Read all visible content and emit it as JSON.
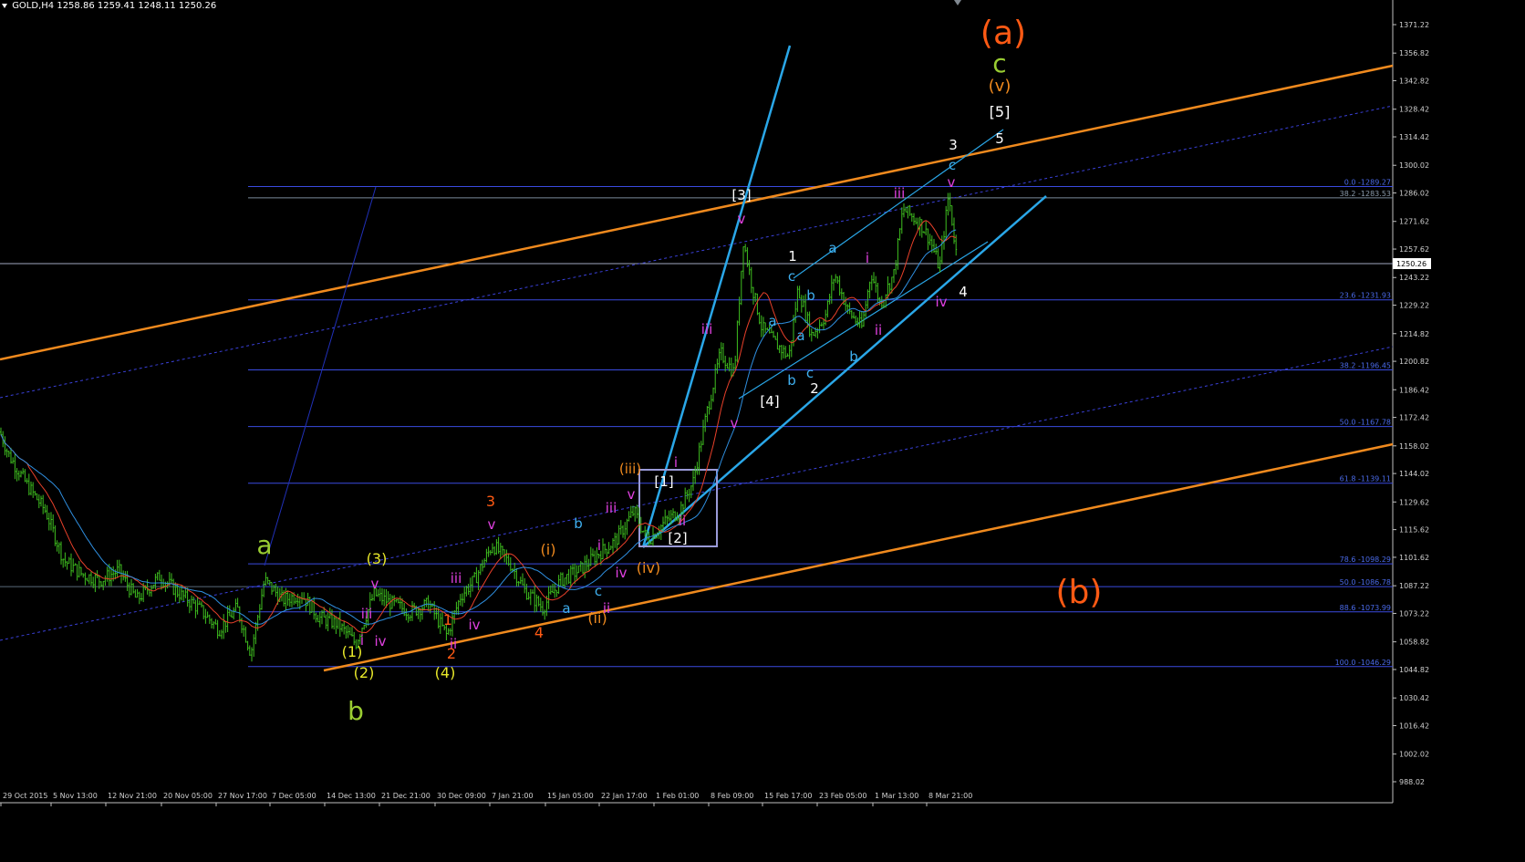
{
  "header": {
    "symbol": "GOLD,H4",
    "ohlc": "1258.86 1259.41 1248.11 1250.26"
  },
  "colors": {
    "background": "#000000",
    "candles": "#3fbf1f",
    "ma_fast": "#e8402a",
    "ma_slow": "#2f8fe0",
    "fib_lines": "#3a4be0",
    "channel_orange": "#f08a1e",
    "channel_dotted": "#3a40d8",
    "trend_cyan": "#2aa7e8",
    "box": "#9a9ad8",
    "axis": "#c0c0c0"
  },
  "chart_data": {
    "type": "candlestick",
    "symbol": "GOLD",
    "timeframe": "H4",
    "last_price": "1250.26",
    "ylim": [
      988.0,
      1381.0
    ],
    "y_ticks": [
      "1371.22",
      "1356.82",
      "1342.82",
      "1328.42",
      "1314.42",
      "1300.02",
      "1286.02",
      "1271.62",
      "1257.62",
      "1243.22",
      "1229.22",
      "1214.82",
      "1200.82",
      "1186.42",
      "1172.42",
      "1158.02",
      "1144.02",
      "1129.62",
      "1115.62",
      "1101.62",
      "1087.22",
      "1073.22",
      "1058.82",
      "1044.82",
      "1030.42",
      "1016.42",
      "1002.02",
      "988.02"
    ],
    "x_ticks": [
      "29 Oct 2015",
      "5 Nov 13:00",
      "12 Nov 21:00",
      "20 Nov 05:00",
      "27 Nov 17:00",
      "7 Dec 05:00",
      "14 Dec 13:00",
      "21 Dec 21:00",
      "30 Dec 09:00",
      "7 Jan 21:00",
      "15 Jan 05:00",
      "22 Jan 17:00",
      "1 Feb 01:00",
      "8 Feb 09:00",
      "15 Feb 17:00",
      "23 Feb 05:00",
      "1 Mar 13:00",
      "8 Mar 21:00"
    ],
    "price_path": [
      [
        0,
        1165
      ],
      [
        10,
        1153
      ],
      [
        30,
        1138
      ],
      [
        50,
        1125
      ],
      [
        70,
        1100
      ],
      [
        90,
        1093
      ],
      [
        110,
        1090
      ],
      [
        130,
        1095
      ],
      [
        150,
        1080
      ],
      [
        175,
        1092
      ],
      [
        200,
        1082
      ],
      [
        220,
        1075
      ],
      [
        240,
        1065
      ],
      [
        260,
        1076
      ],
      [
        275,
        1053
      ],
      [
        290,
        1090
      ],
      [
        310,
        1080
      ],
      [
        330,
        1083
      ],
      [
        350,
        1071
      ],
      [
        370,
        1068
      ],
      [
        390,
        1058
      ],
      [
        410,
        1083
      ],
      [
        430,
        1078
      ],
      [
        450,
        1074
      ],
      [
        470,
        1078
      ],
      [
        490,
        1062
      ],
      [
        505,
        1082
      ],
      [
        520,
        1090
      ],
      [
        540,
        1108
      ],
      [
        560,
        1098
      ],
      [
        575,
        1085
      ],
      [
        595,
        1076
      ],
      [
        615,
        1090
      ],
      [
        635,
        1095
      ],
      [
        655,
        1103
      ],
      [
        675,
        1110
      ],
      [
        695,
        1125
      ],
      [
        710,
        1110
      ],
      [
        730,
        1120
      ],
      [
        745,
        1125
      ],
      [
        760,
        1140
      ],
      [
        775,
        1175
      ],
      [
        790,
        1205
      ],
      [
        805,
        1195
      ],
      [
        815,
        1262
      ],
      [
        825,
        1238
      ],
      [
        835,
        1218
      ],
      [
        850,
        1210
      ],
      [
        865,
        1203
      ],
      [
        875,
        1238
      ],
      [
        890,
        1214
      ],
      [
        905,
        1224
      ],
      [
        915,
        1245
      ],
      [
        930,
        1226
      ],
      [
        945,
        1218
      ],
      [
        955,
        1246
      ],
      [
        965,
        1230
      ],
      [
        980,
        1245
      ],
      [
        990,
        1278
      ],
      [
        1010,
        1270
      ],
      [
        1020,
        1262
      ],
      [
        1030,
        1248
      ],
      [
        1040,
        1285
      ],
      [
        1050,
        1250
      ]
    ],
    "fibonacci": [
      {
        "level": "0.0",
        "value": "1289.27",
        "price": 1289.27
      },
      {
        "level": "38.2",
        "value": "1283.53",
        "price": 1283.53
      },
      {
        "level": "23.6",
        "value": "1231.93",
        "price": 1231.93
      },
      {
        "level": "38.2",
        "value": "1196.45",
        "price": 1196.45
      },
      {
        "level": "50.0",
        "value": "1167.78",
        "price": 1167.78
      },
      {
        "level": "61.8",
        "value": "1139.11",
        "price": 1139.11
      },
      {
        "level": "78.6",
        "value": "1098.29",
        "price": 1098.29
      },
      {
        "level": "50.0",
        "value": "1086.78",
        "price": 1086.78
      },
      {
        "level": "88.6",
        "value": "1073.99",
        "price": 1073.99
      },
      {
        "level": "100.0",
        "value": "1046.29",
        "price": 1046.29
      }
    ],
    "wave_labels": [
      {
        "text": "(a)",
        "color": "#ff5a14",
        "size": 36
      },
      {
        "text": "(b)",
        "color": "#ff5a14",
        "size": 36
      },
      {
        "text": "a",
        "color": "#9acd32",
        "size": 28
      },
      {
        "text": "b",
        "color": "#9acd32",
        "size": 28
      },
      {
        "text": "c",
        "color": "#9acd32",
        "size": 28
      },
      {
        "text": "(v)",
        "color": "#f08a1e",
        "size": 18
      },
      {
        "text": "[5]",
        "color": "#ffffff",
        "size": 16
      },
      {
        "text": "5",
        "color": "#ffffff",
        "size": 15
      },
      {
        "text": "3",
        "color": "#ffffff",
        "size": 15
      },
      {
        "text": "c",
        "color": "#3fb0f0",
        "size": 15
      },
      {
        "text": "v",
        "color": "#e040e0",
        "size": 15
      },
      {
        "text": "iii",
        "color": "#e040e0",
        "size": 15
      },
      {
        "text": "[3]",
        "color": "#ffffff",
        "size": 15
      },
      {
        "text": "v",
        "color": "#e040e0",
        "size": 15
      },
      {
        "text": "1",
        "color": "#ffffff",
        "size": 15
      },
      {
        "text": "a",
        "color": "#3fb0f0",
        "size": 15
      },
      {
        "text": "i",
        "color": "#e040e0",
        "size": 15
      },
      {
        "text": "c",
        "color": "#3fb0f0",
        "size": 15
      },
      {
        "text": "b",
        "color": "#3fb0f0",
        "size": 15
      },
      {
        "text": "a",
        "color": "#3fb0f0",
        "size": 15
      },
      {
        "text": "a",
        "color": "#3fb0f0",
        "size": 15
      },
      {
        "text": "ii",
        "color": "#e040e0",
        "size": 15
      },
      {
        "text": "4",
        "color": "#ffffff",
        "size": 15
      },
      {
        "text": "iv",
        "color": "#e040e0",
        "size": 15
      },
      {
        "text": "iii",
        "color": "#e040e0",
        "size": 15
      },
      {
        "text": "b",
        "color": "#3fb0f0",
        "size": 15
      },
      {
        "text": "c",
        "color": "#3fb0f0",
        "size": 15
      },
      {
        "text": "b",
        "color": "#3fb0f0",
        "size": 15
      },
      {
        "text": "[4]",
        "color": "#ffffff",
        "size": 15
      },
      {
        "text": "2",
        "color": "#ffffff",
        "size": 15
      },
      {
        "text": "v",
        "color": "#e040e0",
        "size": 15
      },
      {
        "text": "i",
        "color": "#e040e0",
        "size": 15
      },
      {
        "text": "(iii)",
        "color": "#f08a1e",
        "size": 15
      },
      {
        "text": "[1]",
        "color": "#ffffff",
        "size": 15
      },
      {
        "text": "[2]",
        "color": "#ffffff",
        "size": 15
      },
      {
        "text": "ii",
        "color": "#e040e0",
        "size": 15
      },
      {
        "text": "v",
        "color": "#e040e0",
        "size": 15
      },
      {
        "text": "iii",
        "color": "#e040e0",
        "size": 15
      },
      {
        "text": "b",
        "color": "#3fb0f0",
        "size": 15
      },
      {
        "text": "i",
        "color": "#e040e0",
        "size": 15
      },
      {
        "text": "(iv)",
        "color": "#f08a1e",
        "size": 16
      },
      {
        "text": "iv",
        "color": "#e040e0",
        "size": 15
      },
      {
        "text": "c",
        "color": "#3fb0f0",
        "size": 15
      },
      {
        "text": "ii",
        "color": "#e040e0",
        "size": 15
      },
      {
        "text": "a",
        "color": "#3fb0f0",
        "size": 15
      },
      {
        "text": "(ii)",
        "color": "#f08a1e",
        "size": 16
      },
      {
        "text": "(i)",
        "color": "#f08a1e",
        "size": 16
      },
      {
        "text": "4",
        "color": "#ff5a14",
        "size": 16
      },
      {
        "text": "3",
        "color": "#ff5a14",
        "size": 16
      },
      {
        "text": "v",
        "color": "#e040e0",
        "size": 15
      },
      {
        "text": "iii",
        "color": "#e040e0",
        "size": 15
      },
      {
        "text": "iv",
        "color": "#e040e0",
        "size": 15
      },
      {
        "text": "1",
        "color": "#ff5a14",
        "size": 16
      },
      {
        "text": "ii",
        "color": "#e040e0",
        "size": 15
      },
      {
        "text": "2",
        "color": "#ff5a14",
        "size": 16
      },
      {
        "text": "(3)",
        "color": "#e8e82a",
        "size": 16
      },
      {
        "text": "v",
        "color": "#e040e0",
        "size": 15
      },
      {
        "text": "iii",
        "color": "#e040e0",
        "size": 15
      },
      {
        "text": "iv",
        "color": "#e040e0",
        "size": 15
      },
      {
        "text": "i",
        "color": "#e040e0",
        "size": 15
      },
      {
        "text": "(1)",
        "color": "#e8e82a",
        "size": 16
      },
      {
        "text": "(2)",
        "color": "#e8e82a",
        "size": 16
      },
      {
        "text": "(4)",
        "color": "#e8e82a",
        "size": 16
      }
    ]
  }
}
